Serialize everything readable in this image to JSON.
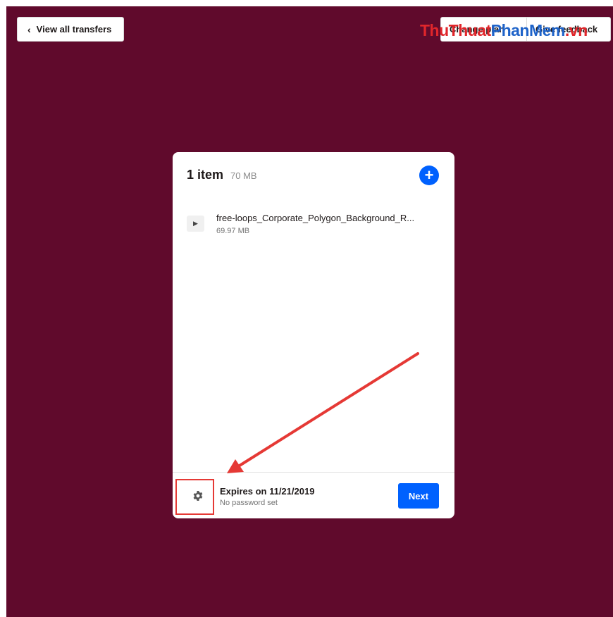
{
  "topbar": {
    "view_all_label": "View all transfers",
    "right_button_1_label": "Change plan",
    "right_button_2_label": "Give feedback"
  },
  "watermark": {
    "part1": "ThuThuat",
    "part2": "PhanMem",
    "part3": ".vn"
  },
  "card": {
    "item_count": "1 item",
    "total_size": "70 MB",
    "files": [
      {
        "name": "free-loops_Corporate_Polygon_Background_R...",
        "size": "69.97 MB"
      }
    ],
    "footer": {
      "expires_title": "Expires on 11/21/2019",
      "expires_sub": "No password set",
      "next_label": "Next"
    }
  },
  "colors": {
    "background": "#600a2c",
    "accent": "#0061fe",
    "annotation": "#e53935"
  },
  "icons": {
    "add": "plus-icon",
    "settings": "gear-icon",
    "back": "chevron-left-icon",
    "file": "play-icon"
  }
}
